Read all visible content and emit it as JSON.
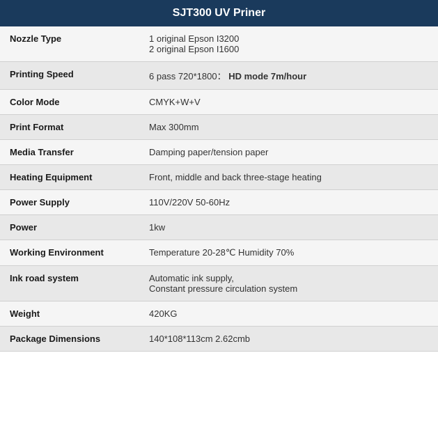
{
  "header": {
    "title": "SJT300 UV Priner"
  },
  "rows": [
    {
      "label": "Nozzle Type",
      "value": "1 original Epson I3200\n2 original Epson I1600",
      "hasHighlight": false
    },
    {
      "label": "Printing Speed",
      "valuePlain": "6 pass 720*1800：",
      "valueHighlight": " HD mode 7m/hour",
      "hasHighlight": true
    },
    {
      "label": "Color Mode",
      "value": "CMYK+W+V",
      "hasHighlight": false
    },
    {
      "label": "Print Format",
      "value": "Max 300mm",
      "hasHighlight": false
    },
    {
      "label": "Media Transfer",
      "value": "Damping paper/tension paper",
      "hasHighlight": false
    },
    {
      "label": "Heating Equipment",
      "value": "Front, middle and back three-stage heating",
      "hasHighlight": false
    },
    {
      "label": "Power Supply",
      "value": "110V/220V 50-60Hz",
      "hasHighlight": false
    },
    {
      "label": "Power",
      "value": "1kw",
      "hasHighlight": false
    },
    {
      "label": "Working Environment",
      "value": "Temperature 20-28℃ Humidity 70%",
      "hasHighlight": false
    },
    {
      "label": "Ink road system",
      "value": "Automatic ink supply,\nConstant pressure circulation system",
      "hasHighlight": false
    },
    {
      "label": "Weight",
      "value": "420KG",
      "hasHighlight": false
    },
    {
      "label": "Package Dimensions",
      "value": "140*108*113cm 2.62cmb",
      "hasHighlight": false
    }
  ]
}
